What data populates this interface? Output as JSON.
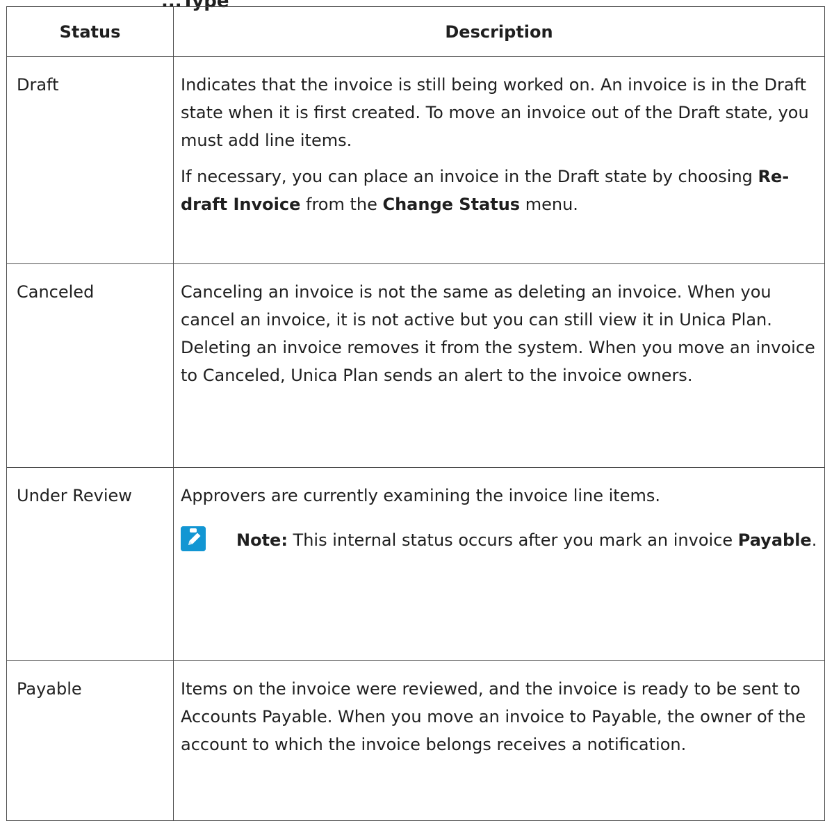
{
  "caption": "...Type",
  "header": {
    "status": "Status",
    "description": "Description"
  },
  "rows": [
    {
      "status": "Draft",
      "p1": "Indicates that the invoice is still being worked on. An invoice is in the Draft state when it is first created. To move an invoice out of the Draft state, you must add line items.",
      "p2_pre": "If necessary, you can place an invoice in the Draft state by choosing ",
      "p2_bold1": "Re-draft Invoice",
      "p2_mid": " from the ",
      "p2_bold2": "Change Status",
      "p2_post": " menu."
    },
    {
      "status": "Canceled",
      "p1": "Canceling an invoice is not the same as deleting an invoice. When you cancel an invoice, it is not active but you can still view it in Unica Plan. Deleting an invoice removes it from the system. When you move an invoice to Canceled, Unica Plan sends an alert to the invoice owners."
    },
    {
      "status": "Under Review",
      "p1": "Approvers are currently examining the invoice line items.",
      "note_label": "Note:",
      "note_text": " This internal status occurs after you mark an invoice ",
      "note_bold": "Payable",
      "note_end": ".",
      "note_icon": "note-pencil-icon"
    },
    {
      "status": "Payable",
      "p1": "Items on the invoice were reviewed, and the invoice is ready to be sent to Accounts Payable. When you move an invoice to Payable, the owner of the account to which the invoice belongs receives a notification."
    }
  ],
  "colors": {
    "border": "#4d4d4d",
    "note_icon_bg": "#1296d3"
  }
}
